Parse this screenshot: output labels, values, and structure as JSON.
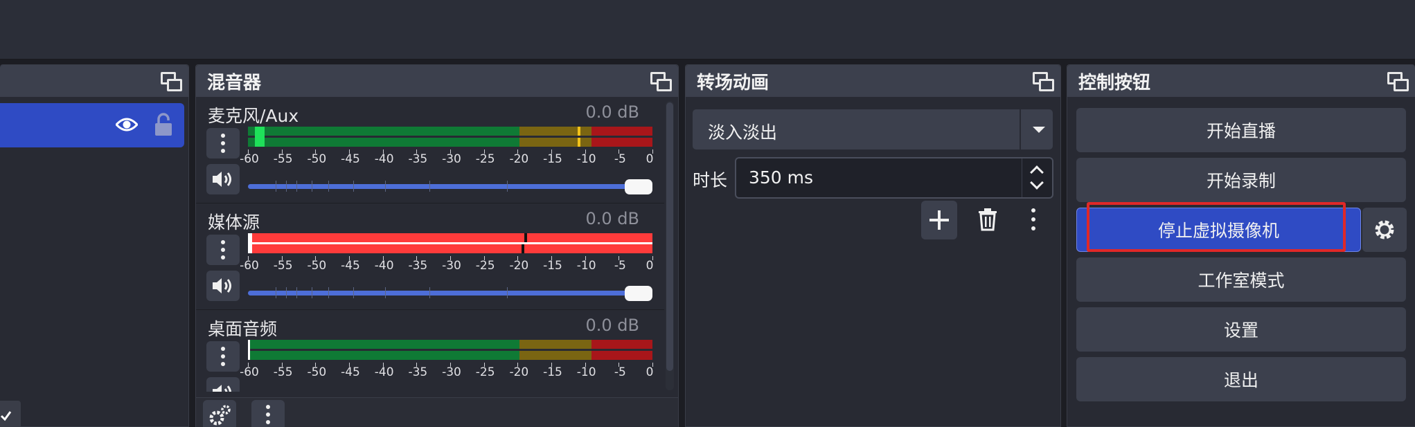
{
  "mixer": {
    "title": "混音器",
    "channels": [
      {
        "name": "麦克风/Aux",
        "level": "0.0 dB",
        "meter_style": "normal"
      },
      {
        "name": "媒体源",
        "level": "0.0 dB",
        "meter_style": "clipping"
      },
      {
        "name": "桌面音频",
        "level": "0.0 dB",
        "meter_style": "normal"
      }
    ],
    "scale_labels": [
      "-60",
      "-55",
      "-50",
      "-45",
      "-40",
      "-35",
      "-30",
      "-25",
      "-20",
      "-15",
      "-10",
      "-5",
      "0"
    ],
    "volume_fraction": 1.0
  },
  "transitions": {
    "title": "转场动画",
    "selected": "淡入淡出",
    "duration_label": "时长",
    "duration_value": "350 ms"
  },
  "controls": {
    "title": "控制按钮",
    "buttons": {
      "start_stream": "开始直播",
      "start_record": "开始录制",
      "stop_virtualcam": "停止虚拟摄像机",
      "studio_mode": "工作室模式",
      "settings": "设置",
      "exit": "退出"
    }
  },
  "icons": {
    "float": "undock-icon",
    "visibility": "eye-icon",
    "lock": "unlock-icon",
    "menu": "vertical-dots-icon",
    "volume": "speaker-icon",
    "add": "plus-icon",
    "delete": "trash-icon",
    "gear": "gear-icon"
  },
  "colors": {
    "accent": "#2f4bc4",
    "highlight": "#e02828",
    "meter_green": "#0f7a35",
    "meter_yellow": "#7a6512",
    "meter_red": "#a8161a"
  }
}
